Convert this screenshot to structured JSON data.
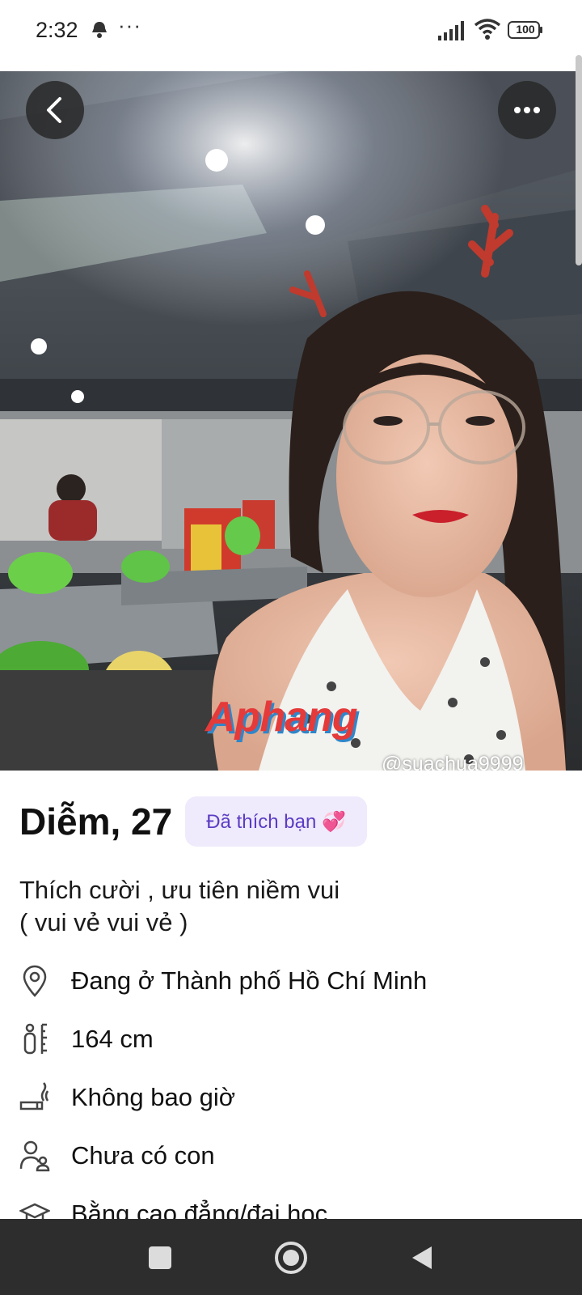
{
  "status_bar": {
    "time": "2:32",
    "more": "···",
    "battery": "100"
  },
  "photo": {
    "watermark": "Aphang",
    "tiktok_tag": "@suachua9999"
  },
  "profile": {
    "name": "Diễm, 27",
    "badge": "Đã thích bạn 💞",
    "bio": "Thích cười , ưu tiên niềm vui\n( vui vẻ vui vẻ )",
    "details": [
      {
        "icon": "location-pin-icon",
        "text": "Đang ở Thành phố Hồ Chí Minh"
      },
      {
        "icon": "height-icon",
        "text": "164 cm"
      },
      {
        "icon": "smoking-icon",
        "text": "Không bao giờ"
      },
      {
        "icon": "children-icon",
        "text": "Chưa có con"
      },
      {
        "icon": "graduation-cap-icon",
        "text": "Bằng cao đẳng/đại học"
      }
    ]
  },
  "nav_bar": {
    "buttons": [
      "recent-apps",
      "home",
      "back"
    ]
  }
}
